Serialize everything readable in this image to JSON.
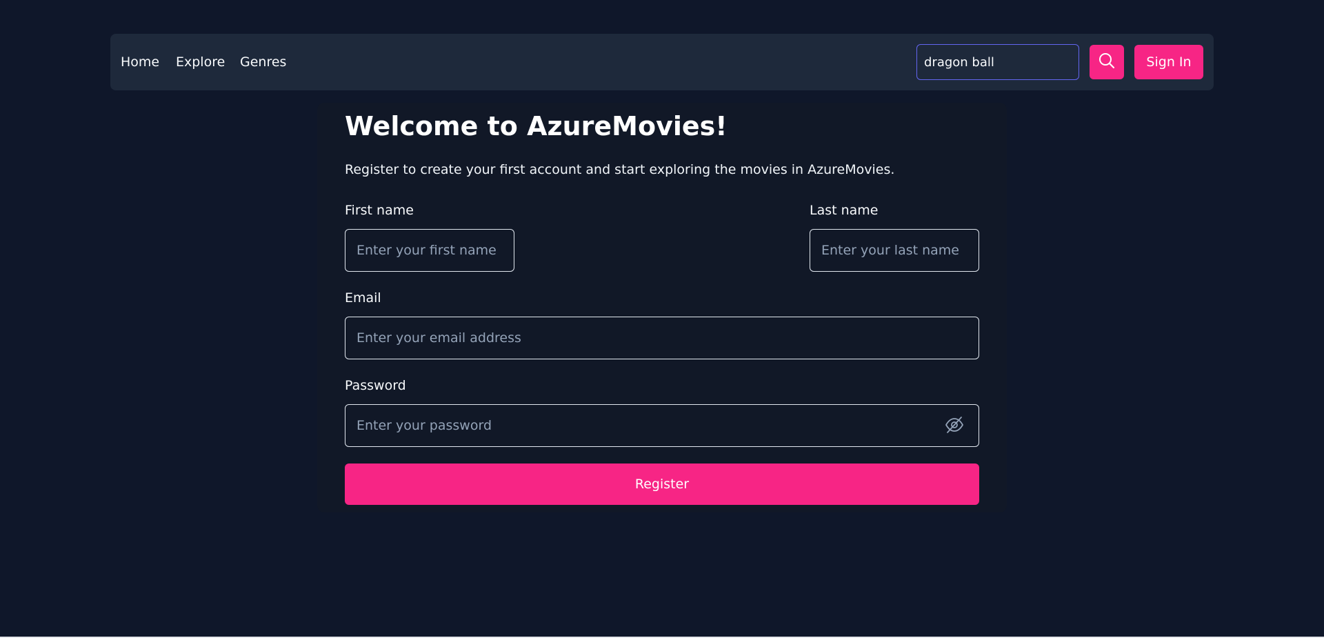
{
  "nav": {
    "links": [
      "Home",
      "Explore",
      "Genres"
    ],
    "search": {
      "value": "dragon ball",
      "icon": "search-icon"
    },
    "signin_label": "Sign In"
  },
  "form": {
    "title": "Welcome to AzureMovies!",
    "subtitle": "Register to create your first account and start exploring the movies in AzureMovies.",
    "first_name": {
      "label": "First name",
      "placeholder": "Enter your first name"
    },
    "last_name": {
      "label": "Last name",
      "placeholder": "Enter your last name"
    },
    "email": {
      "label": "Email",
      "placeholder": "Enter your email address"
    },
    "password": {
      "label": "Password",
      "placeholder": "Enter your password",
      "icon": "eye-off-icon"
    },
    "register_label": "Register"
  },
  "colors": {
    "background": "#0f172a",
    "navbar": "#1e293b",
    "card": "#111827",
    "accent": "#f72585",
    "search_border": "#6366f1"
  }
}
